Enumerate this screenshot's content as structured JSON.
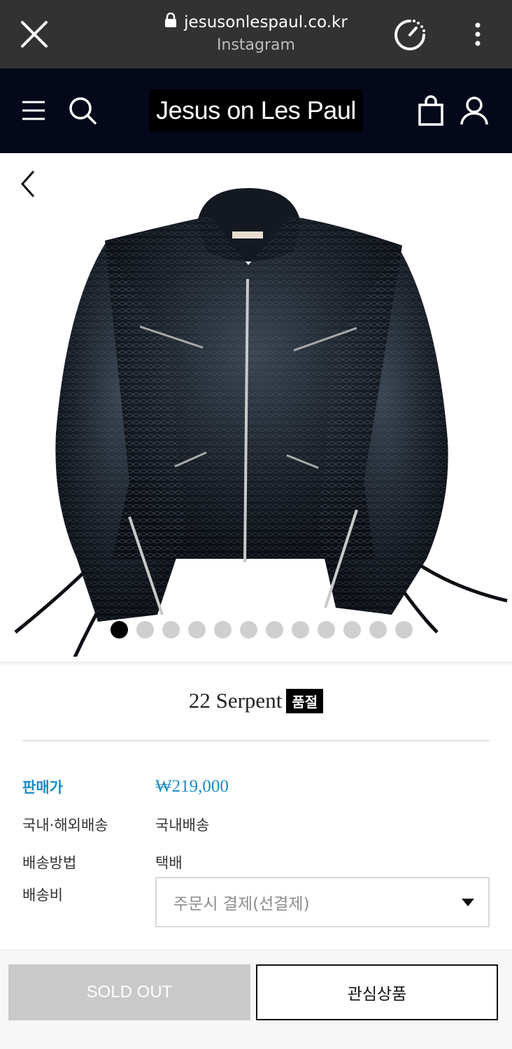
{
  "browser": {
    "url": "jesusonlespaul.co.kr",
    "source": "Instagram"
  },
  "header": {
    "logo_text": "Jesus on Les Paul"
  },
  "gallery": {
    "image_count": 12,
    "active_index": 0
  },
  "product": {
    "name": "22 Serpent",
    "badge": "품절"
  },
  "info": {
    "price_label": "판매가",
    "price_value": "₩219,000",
    "shipping_region_label": "국내·해외배송",
    "shipping_region_value": "국내배송",
    "shipping_method_label": "배송방법",
    "shipping_method_value": "택배",
    "shipping_fee_label": "배송비",
    "shipping_fee_selected": "주문시 결제(선결제)"
  },
  "actions": {
    "soldout_label": "SOLD OUT",
    "wishlist_label": "관심상품"
  },
  "colors": {
    "browser_bar": "#323232",
    "site_header": "#05071a",
    "price_accent": "#1a8bc4",
    "disabled_button": "#c9c9c9"
  }
}
